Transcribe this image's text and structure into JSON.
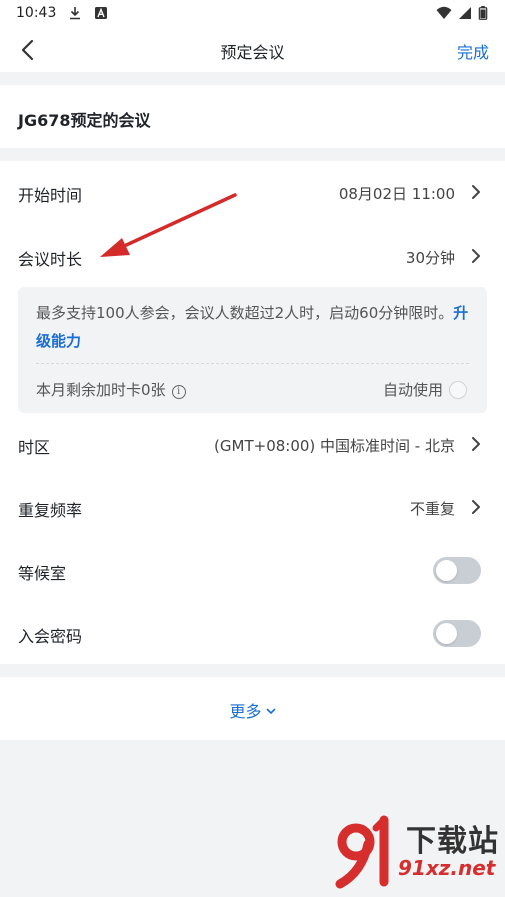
{
  "status_bar": {
    "time": "10:43",
    "icons": [
      "download-icon",
      "a-icon",
      "wifi-icon",
      "signal-icon",
      "battery-icon"
    ]
  },
  "nav": {
    "title": "预定会议",
    "done_label": "完成",
    "back_icon": "chevron-left-icon"
  },
  "meeting": {
    "name": "JG678预定的会议"
  },
  "rows": {
    "start_time": {
      "label": "开始时间",
      "value": "08月02日 11:00"
    },
    "duration": {
      "label": "会议时长",
      "value": "30分钟"
    },
    "timezone": {
      "label": "时区",
      "value": "(GMT+08:00) 中国标准时间 - 北京"
    },
    "repeat": {
      "label": "重复频率",
      "value": "不重复"
    },
    "waiting_room": {
      "label": "等候室",
      "enabled": false
    },
    "password": {
      "label": "入会密码",
      "enabled": false
    }
  },
  "info": {
    "text": "最多支持100人参会，会议人数超过2人时，启动60分钟限时。",
    "upgrade_label": "升级能力",
    "remaining_cards": "本月剩余加时卡0张",
    "auto_use_label": "自动使用",
    "auto_use_checked": false
  },
  "more": {
    "label": "更多"
  },
  "watermark": {
    "brand": "下载站",
    "url": "91xz.net"
  },
  "colors": {
    "accent": "#1a6fd5",
    "annotation_arrow": "#d42a2a",
    "toggle_off": "#c9cdd4",
    "page_bg": "#f2f3f5"
  }
}
